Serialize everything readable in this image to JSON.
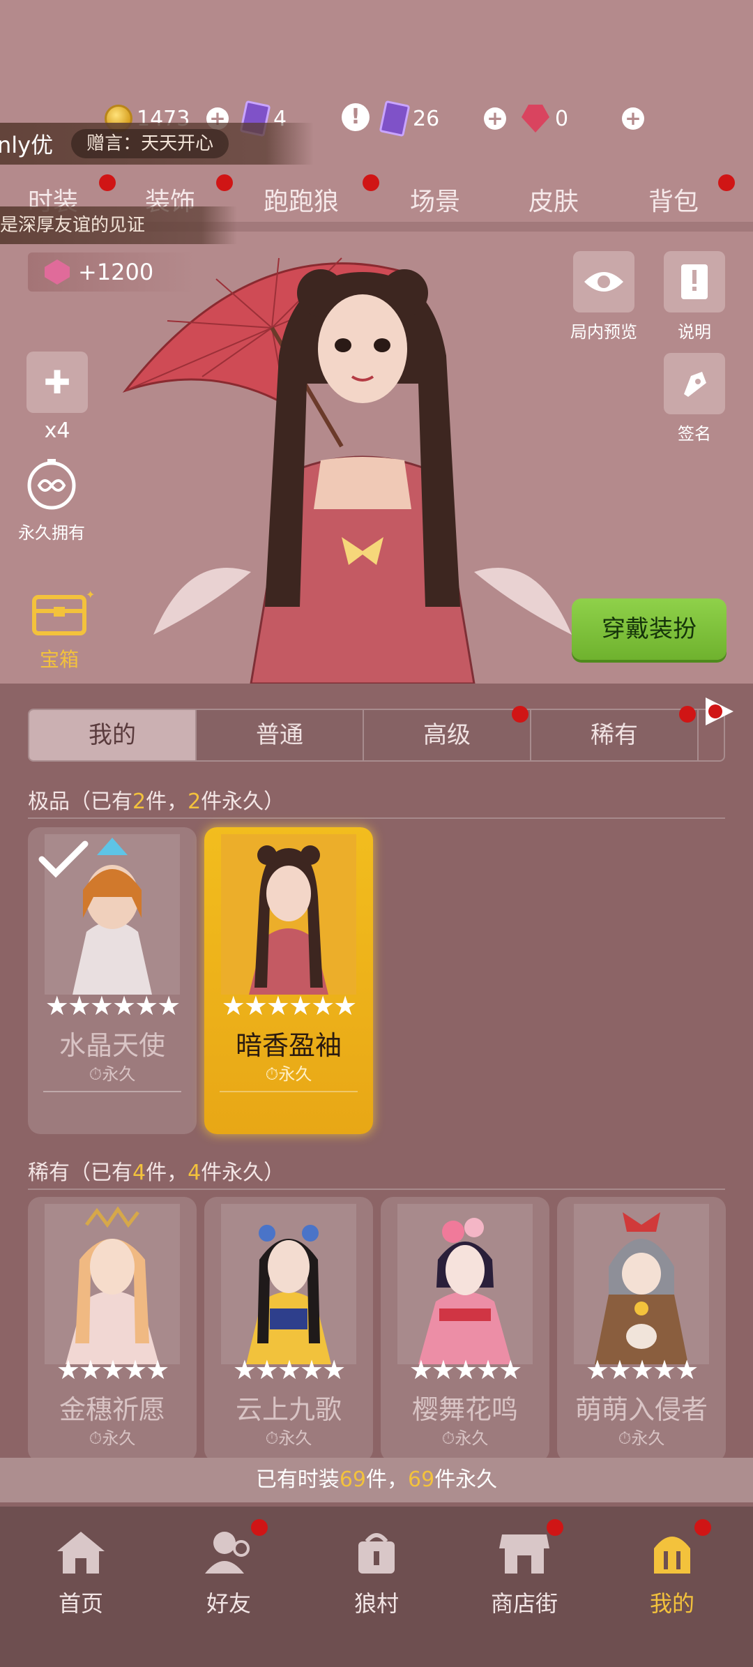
{
  "currency": {
    "coins": "1473",
    "cards": "4",
    "tickets": "26",
    "gems": "0"
  },
  "gift": {
    "sender": "nly优",
    "message": "赠言：天天开心",
    "friendship_note": "是深厚友谊的见证"
  },
  "main_tabs": [
    "时装",
    "装饰",
    "跑跑狼",
    "场景",
    "皮肤",
    "背包"
  ],
  "score_bonus": "+1200",
  "side_buttons": {
    "puzzle_count": "x4",
    "permanent_label": "永久拥有",
    "preview_label": "局内预览",
    "explain_label": "说明",
    "sign_label": "签名",
    "chest_label": "宝箱"
  },
  "equip_button": "穿戴装扮",
  "rarity_tabs": [
    "我的",
    "普通",
    "高级",
    "稀有"
  ],
  "sections": [
    {
      "title_prefix": "极品（已有",
      "owned": "2",
      "title_mid": "件，",
      "permanent": "2",
      "title_suffix": "件永久）",
      "items": [
        {
          "name": "水晶天使",
          "duration": "永久",
          "stars": "★★★★★★",
          "selected": false,
          "equipped": true
        },
        {
          "name": "暗香盈袖",
          "duration": "永久",
          "stars": "★★★★★★",
          "selected": true,
          "equipped": false
        }
      ]
    },
    {
      "title_prefix": "稀有（已有",
      "owned": "4",
      "title_mid": "件，",
      "permanent": "4",
      "title_suffix": "件永久）",
      "items": [
        {
          "name": "金穗祈愿",
          "duration": "永久",
          "stars": "★★★★★"
        },
        {
          "name": "云上九歌",
          "duration": "永久",
          "stars": "★★★★★"
        },
        {
          "name": "樱舞花鸣",
          "duration": "永久",
          "stars": "★★★★★"
        },
        {
          "name": "萌萌入侵者",
          "duration": "永久",
          "stars": "★★★★★"
        }
      ]
    }
  ],
  "summary": {
    "prefix": "已有时装",
    "owned": "69",
    "mid": "件，",
    "permanent": "69",
    "suffix": "件永久"
  },
  "bottom_nav": [
    "首页",
    "好友",
    "狼村",
    "商店街",
    "我的"
  ],
  "colors": {
    "accent_gold": "#f3c23c",
    "equip_green": "#7ec23a",
    "notification_red": "#d01515",
    "panel_brown": "#8c6466"
  }
}
